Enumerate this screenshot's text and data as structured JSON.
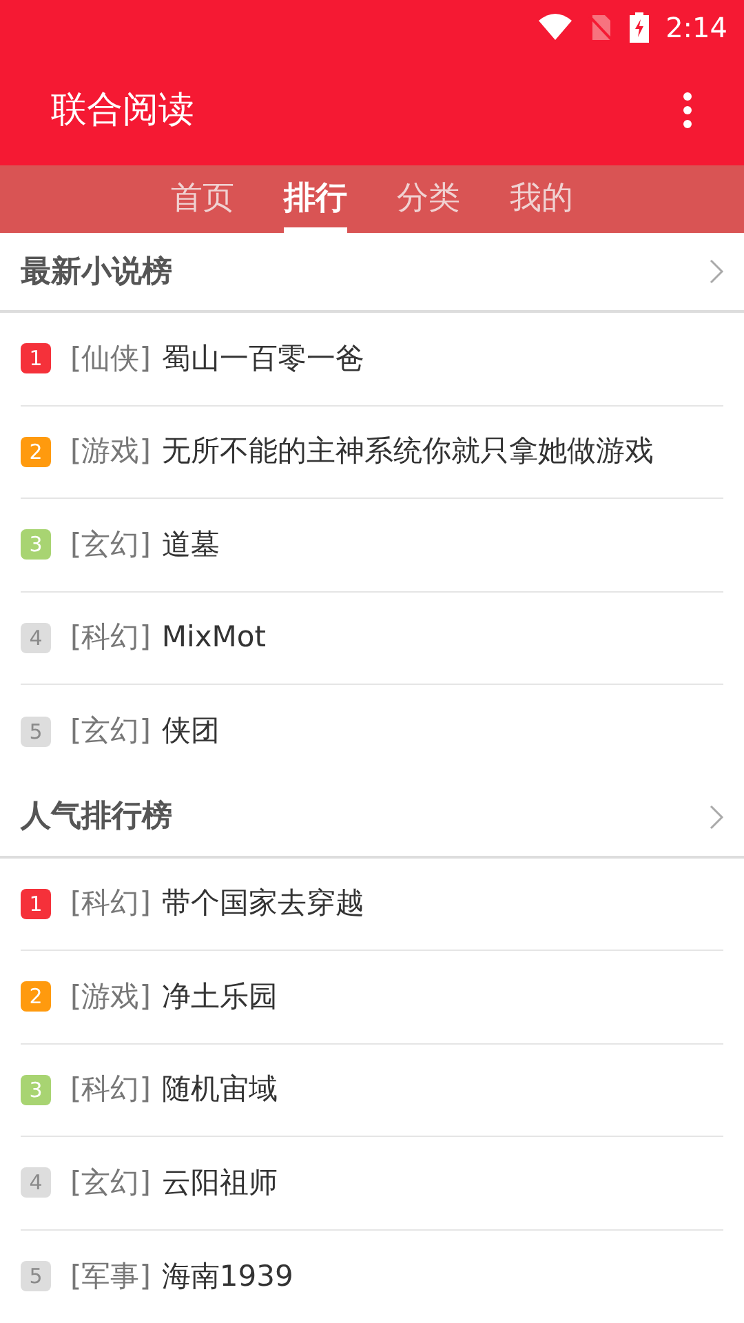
{
  "status_bar": {
    "time": "2:14"
  },
  "app_bar": {
    "title": "联合阅读"
  },
  "tabs": [
    {
      "label": "首页",
      "selected": false
    },
    {
      "label": "排行",
      "selected": true
    },
    {
      "label": "分类",
      "selected": false
    },
    {
      "label": "我的",
      "selected": false
    }
  ],
  "sections": [
    {
      "title": "最新小说榜",
      "items": [
        {
          "rank": "1",
          "color": "#f5313a",
          "genre": "[仙侠]",
          "title": "蜀山一百零一爸"
        },
        {
          "rank": "2",
          "color": "#ff9a0e",
          "genre": "[游戏]",
          "title": "无所不能的主神系统你就只拿她做游戏"
        },
        {
          "rank": "3",
          "color": "#a8d472",
          "genre": "[玄幻]",
          "title": "道墓"
        },
        {
          "rank": "4",
          "color": "#dddddd",
          "genre": "[科幻]",
          "title": "MixMot"
        },
        {
          "rank": "5",
          "color": "#dddddd",
          "genre": "[玄幻]",
          "title": "侠团"
        }
      ]
    },
    {
      "title": "人气排行榜",
      "items": [
        {
          "rank": "1",
          "color": "#f5313a",
          "genre": "[科幻]",
          "title": "带个国家去穿越"
        },
        {
          "rank": "2",
          "color": "#ff9a0e",
          "genre": "[游戏]",
          "title": "净土乐园"
        },
        {
          "rank": "3",
          "color": "#a8d472",
          "genre": "[科幻]",
          "title": "随机宙域"
        },
        {
          "rank": "4",
          "color": "#dddddd",
          "genre": "[玄幻]",
          "title": "云阳祖师"
        },
        {
          "rank": "5",
          "color": "#dddddd",
          "genre": "[军事]",
          "title": "海南1939"
        }
      ]
    }
  ]
}
